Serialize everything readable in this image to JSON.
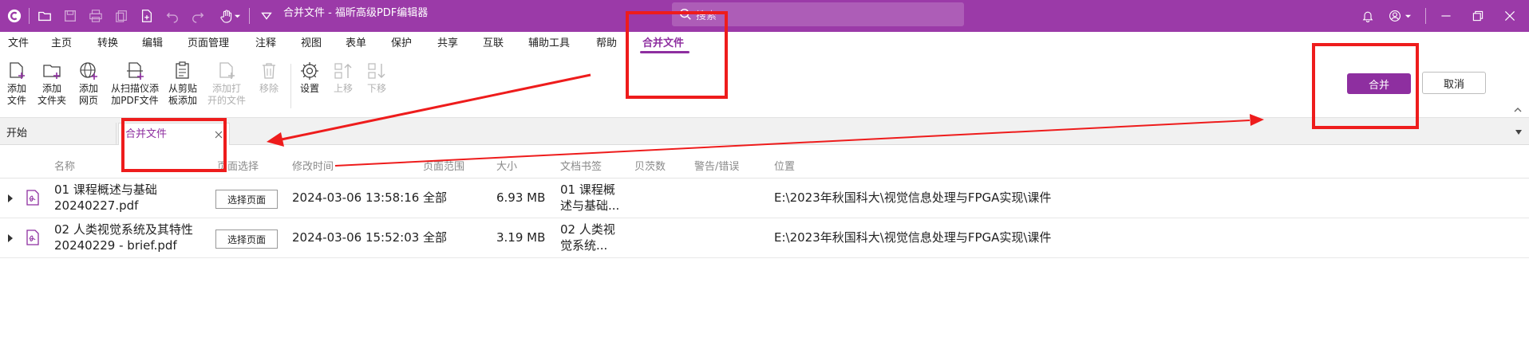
{
  "app": {
    "title": "合并文件 - 福昕高级PDF编辑器",
    "search_placeholder": "搜索",
    "accent": "#9b3aa8"
  },
  "menu": [
    "文件",
    "主页",
    "转换",
    "编辑",
    "页面管理",
    "注释",
    "视图",
    "表单",
    "保护",
    "共享",
    "互联",
    "辅助工具",
    "帮助",
    "合并文件"
  ],
  "ribbon": {
    "add_file": [
      "添加",
      "文件"
    ],
    "add_folder": [
      "添加",
      "文件夹"
    ],
    "add_webpage": [
      "添加",
      "网页"
    ],
    "add_from_scanner": [
      "从扫描仪添",
      "加PDF文件"
    ],
    "add_from_clipboard": [
      "从剪贴",
      "板添加"
    ],
    "add_open_files": [
      "添加打",
      "开的文件"
    ],
    "remove": "移除",
    "settings": "设置",
    "move_up": "上移",
    "move_down": "下移",
    "merge_button": "合并",
    "cancel_button": "取消"
  },
  "tabs": [
    "开始",
    "合并文件"
  ],
  "table": {
    "headers": [
      "名称",
      "页面选择",
      "修改时间",
      "页面范围",
      "大小",
      "文档书签",
      "贝茨数",
      "警告/错误",
      "位置"
    ],
    "rows": [
      {
        "name_line1": "01 课程概述与基础",
        "name_line2": "20240227.pdf",
        "page_select": "选择页面",
        "modified": "2024-03-06 13:58:16",
        "range": "全部",
        "size": "6.93 MB",
        "bookmark_line1": "01 课程概",
        "bookmark_line2": "述与基础...",
        "location": "E:\\2023年秋国科大\\视觉信息处理与FPGA实现\\课件"
      },
      {
        "name_line1": "02 人类视觉系统及其特性",
        "name_line2": "20240229 - brief.pdf",
        "page_select": "选择页面",
        "modified": "2024-03-06 15:52:03",
        "range": "全部",
        "size": "3.19 MB",
        "bookmark_line1": "02 人类视",
        "bookmark_line2": "觉系统...",
        "location": "E:\\2023年秋国科大\\视觉信息处理与FPGA实现\\课件"
      }
    ]
  }
}
